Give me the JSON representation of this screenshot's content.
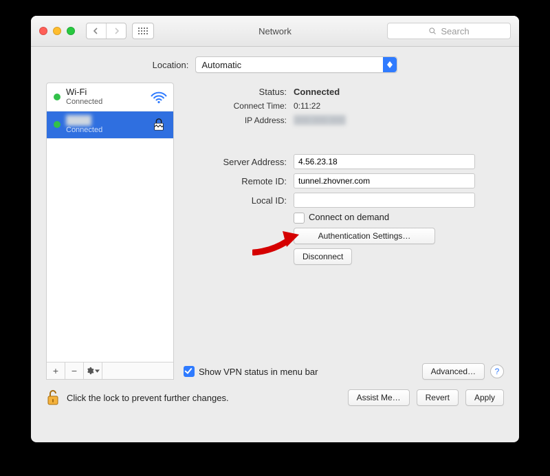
{
  "window": {
    "title": "Network",
    "search_placeholder": "Search"
  },
  "location": {
    "label": "Location:",
    "value": "Automatic"
  },
  "sidebar": {
    "items": [
      {
        "name": "Wi-Fi",
        "status": "Connected",
        "icon": "wifi-icon",
        "status_color": "#32c14a"
      },
      {
        "name": "[redacted]",
        "status": "Connected",
        "icon": "lock-icon",
        "status_color": "#32c14a",
        "selected": true
      }
    ],
    "footer_buttons": [
      "add",
      "remove",
      "actions"
    ]
  },
  "detail": {
    "status": {
      "label": "Status:",
      "value": "Connected"
    },
    "connect_time": {
      "label": "Connect Time:",
      "value": "0:11:22"
    },
    "ip_address": {
      "label": "IP Address:",
      "value": "[redacted]"
    },
    "server_address": {
      "label": "Server Address:",
      "value": "4.56.23.18"
    },
    "remote_id": {
      "label": "Remote ID:",
      "value": "tunnel.zhovner.com"
    },
    "local_id": {
      "label": "Local ID:",
      "value": ""
    },
    "connect_on_demand": "Connect on demand",
    "connect_on_demand_checked": false,
    "auth_button": "Authentication Settings…",
    "disconnect_button": "Disconnect",
    "show_vpn_status": "Show VPN status in menu bar",
    "show_vpn_status_checked": true,
    "advanced_button": "Advanced…"
  },
  "footer": {
    "lock_hint": "Click the lock to prevent further changes.",
    "assist": "Assist Me…",
    "revert": "Revert",
    "apply": "Apply"
  },
  "annotation": {
    "type": "arrow",
    "color": "#d50000",
    "points_to": "connect-on-demand-row"
  }
}
